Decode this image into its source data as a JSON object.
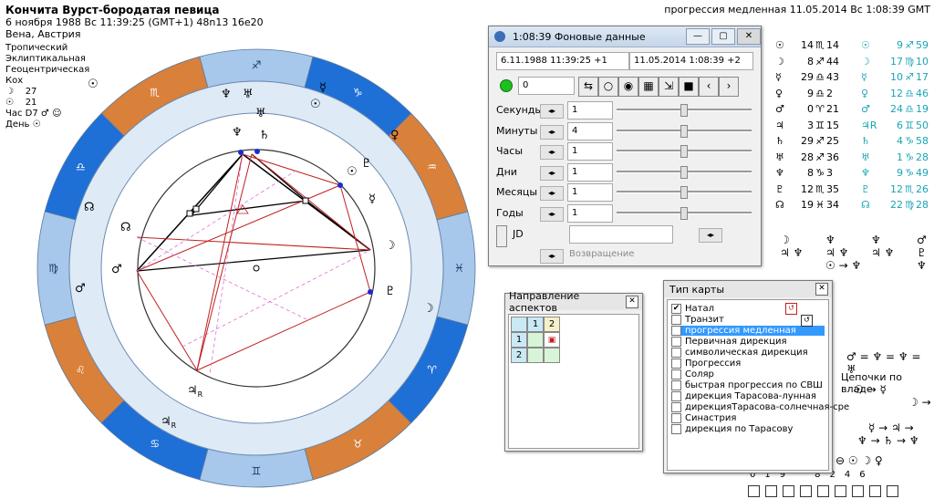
{
  "header": {
    "title": "Кончита Вурст-бородатая певица",
    "line2": "6 ноября 1988  Вс  11:39:25 (GMT+1) 48n13  16e20",
    "line3": "Вена, Австрия",
    "info": [
      "Тропический",
      "Эклиптикальная",
      "Геоцентрическая",
      "Кох"
    ],
    "moon_val": "27",
    "sun_val": "21",
    "hour_label": "Час D7",
    "day_label": "День"
  },
  "top_right": "прогрессия медленная 11.05.2014  Вс  1:08:39 GMT",
  "planets": [
    {
      "glyph": "☉",
      "deg": "14",
      "sign": "♏",
      "min": "14"
    },
    {
      "glyph": "☽",
      "deg": "8",
      "sign": "♐",
      "min": "44"
    },
    {
      "glyph": "☿",
      "deg": "29",
      "sign": "♎",
      "min": "43"
    },
    {
      "glyph": "♀",
      "deg": "9",
      "sign": "♎",
      "min": "2"
    },
    {
      "glyph": "♂",
      "deg": "0",
      "sign": "♈",
      "min": "21"
    },
    {
      "glyph": "♃",
      "deg": "3",
      "sign": "♊",
      "min": "15"
    },
    {
      "glyph": "♄",
      "deg": "29",
      "sign": "♐",
      "min": "25"
    },
    {
      "glyph": "♅",
      "deg": "28",
      "sign": "♐",
      "min": "36"
    },
    {
      "glyph": "♆",
      "deg": "8",
      "sign": "♑",
      "min": "3"
    },
    {
      "glyph": "♇",
      "deg": "12",
      "sign": "♏",
      "min": "35"
    },
    {
      "glyph": "☊",
      "deg": "19",
      "sign": "♓",
      "min": "34"
    }
  ],
  "cyan_planets": [
    {
      "glyph": "☉",
      "deg": "9",
      "sign": "♐",
      "min": "59"
    },
    {
      "glyph": "☽",
      "deg": "17",
      "sign": "♍",
      "min": "10"
    },
    {
      "glyph": "☿",
      "deg": "10",
      "sign": "♐",
      "min": "17"
    },
    {
      "glyph": "♀",
      "deg": "12",
      "sign": "♎",
      "min": "46"
    },
    {
      "glyph": "♂",
      "deg": "24",
      "sign": "♎",
      "min": "19"
    },
    {
      "glyph": "♃R",
      "deg": "6",
      "sign": "♊",
      "min": "50"
    },
    {
      "glyph": "♄",
      "deg": "4",
      "sign": "♑",
      "min": "58"
    },
    {
      "glyph": "♅",
      "deg": "1",
      "sign": "♑",
      "min": "28"
    },
    {
      "glyph": "♆",
      "deg": "9",
      "sign": "♑",
      "min": "49"
    },
    {
      "glyph": "♇",
      "deg": "12",
      "sign": "♏",
      "min": "26"
    },
    {
      "glyph": "☊",
      "deg": "22",
      "sign": "♍",
      "min": "28"
    }
  ],
  "bottom_right": {
    "aspects_row": "♂ = ♆ = ♆ = ♅",
    "chains_label": "Цепочки по владе",
    "chain1": "☉ → ☿",
    "chain2": "☽ →",
    "chain3": "☿ → ♃ →",
    "chain4": "♆ → ♄ → ♆",
    "numbers": [
      "0",
      "1",
      "9",
      "8",
      "2",
      "4",
      "6"
    ]
  },
  "win_bg": {
    "title": "1:08:39 Фоновые данные",
    "date1": "6.11.1988  11:39:25  +1",
    "date2": "11.05.2014    1:08:39  +2",
    "counter": "0",
    "rows": [
      {
        "label": "Секунды",
        "value": "1"
      },
      {
        "label": "Минуты",
        "value": "4"
      },
      {
        "label": "Часы",
        "value": "1"
      },
      {
        "label": "Дни",
        "value": "1"
      },
      {
        "label": "Месяцы",
        "value": "1"
      },
      {
        "label": "Годы",
        "value": "1"
      }
    ],
    "jd_label": "JD",
    "return_label": "Возвращение"
  },
  "win_aspects": {
    "title": "Направление аспектов",
    "col1": "1",
    "col2": "2",
    "row1": "1",
    "row2": "2"
  },
  "win_chart_type": {
    "title": "Тип карты",
    "items": [
      {
        "label": "Натал",
        "checked": "✔"
      },
      {
        "label": "Транзит",
        "checked": ""
      },
      {
        "label": "прогрессия медленная",
        "checked": "✔"
      },
      {
        "label": "Первичная дирекция",
        "checked": ""
      },
      {
        "label": "символическая дирекция",
        "checked": ""
      },
      {
        "label": "Прогрессия",
        "checked": ""
      },
      {
        "label": "Соляр",
        "checked": ""
      },
      {
        "label": "быстрая прогрессия по СВШ",
        "checked": ""
      },
      {
        "label": "дирекция Тарасова-лунная",
        "checked": ""
      },
      {
        "label": "дирекцияТарасова-солнечная-сре",
        "checked": ""
      },
      {
        "label": "Синастрия",
        "checked": ""
      },
      {
        "label": "дирекция по Тарасову",
        "checked": ""
      }
    ]
  },
  "colors": {
    "ring_blue": "#1e6fd6",
    "ring_light": "#a7c8ea",
    "ring_orange": "#d9803a",
    "inner": "#dfeaf7",
    "cyan": "#19a5b5",
    "aspect_red": "#c02020"
  }
}
